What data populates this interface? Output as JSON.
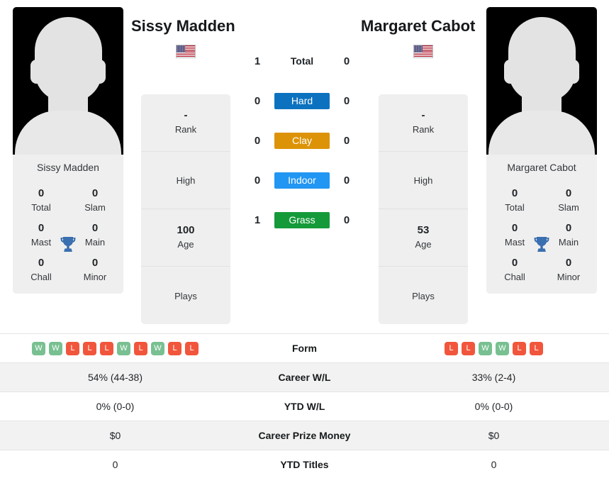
{
  "players": {
    "left": {
      "name": "Sissy Madden",
      "card_name": "Sissy Madden",
      "flag": "us-flag-icon",
      "rank": "-",
      "rank_label": "Rank",
      "high": "",
      "high_label": "High",
      "age": "100",
      "age_label": "Age",
      "plays": "",
      "plays_label": "Plays",
      "titles": {
        "total": "0",
        "total_label": "Total",
        "slam": "0",
        "slam_label": "Slam",
        "mast": "0",
        "mast_label": "Mast",
        "main": "0",
        "main_label": "Main",
        "chall": "0",
        "chall_label": "Chall",
        "minor": "0",
        "minor_label": "Minor"
      },
      "form": [
        "W",
        "W",
        "L",
        "L",
        "L",
        "W",
        "L",
        "W",
        "L",
        "L"
      ],
      "career_wl": "54% (44-38)",
      "ytd_wl": "0% (0-0)",
      "career_prize_money": "$0",
      "ytd_titles": "0"
    },
    "right": {
      "name": "Margaret Cabot",
      "card_name": "Margaret Cabot",
      "flag": "us-flag-icon",
      "rank": "-",
      "rank_label": "Rank",
      "high": "",
      "high_label": "High",
      "age": "53",
      "age_label": "Age",
      "plays": "",
      "plays_label": "Plays",
      "titles": {
        "total": "0",
        "total_label": "Total",
        "slam": "0",
        "slam_label": "Slam",
        "mast": "0",
        "mast_label": "Mast",
        "main": "0",
        "main_label": "Main",
        "chall": "0",
        "chall_label": "Chall",
        "minor": "0",
        "minor_label": "Minor"
      },
      "form": [
        "L",
        "L",
        "W",
        "W",
        "L",
        "L"
      ],
      "career_wl": "33% (2-4)",
      "ytd_wl": "0% (0-0)",
      "career_prize_money": "$0",
      "ytd_titles": "0"
    }
  },
  "head_to_head": {
    "rows": [
      {
        "label": "Total",
        "left": "1",
        "right": "0",
        "color": ""
      },
      {
        "label": "Hard",
        "left": "0",
        "right": "0",
        "color": "#0c72c0"
      },
      {
        "label": "Clay",
        "left": "0",
        "right": "0",
        "color": "#dd9307"
      },
      {
        "label": "Indoor",
        "left": "0",
        "right": "0",
        "color": "#2196f3"
      },
      {
        "label": "Grass",
        "left": "1",
        "right": "0",
        "color": "#159a3a"
      }
    ]
  },
  "stats_table": {
    "form_label": "Form",
    "rows": [
      {
        "label": "Career W/L",
        "left": "54% (44-38)",
        "right": "33% (2-4)"
      },
      {
        "label": "YTD W/L",
        "left": "0% (0-0)",
        "right": "0% (0-0)"
      },
      {
        "label": "Career Prize Money",
        "left": "$0",
        "right": "$0"
      },
      {
        "label": "YTD Titles",
        "left": "0",
        "right": "0"
      }
    ]
  },
  "colors": {
    "hard": "#0c72c0",
    "clay": "#dd9307",
    "indoor": "#2196f3",
    "grass": "#159a3a",
    "win_badge": "#78c091",
    "loss_badge": "#f1563c",
    "card_bg": "#efefef",
    "trophy": "#3a6fb0"
  }
}
